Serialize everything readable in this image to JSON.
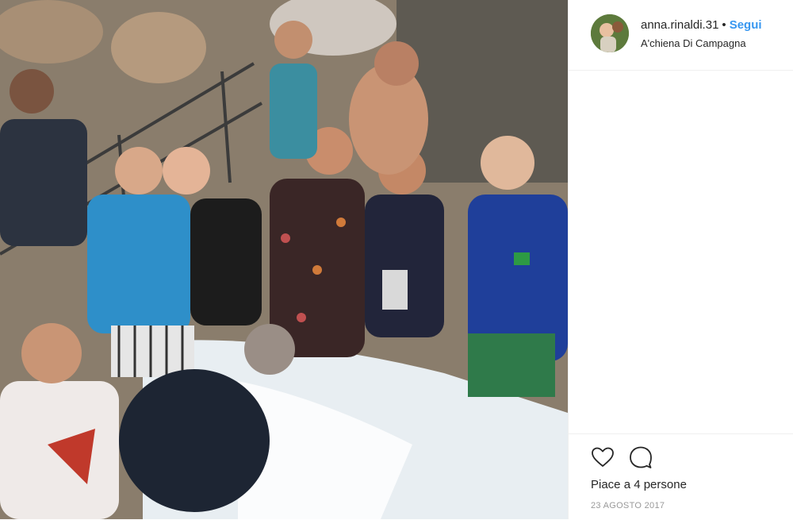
{
  "post": {
    "username": "anna.rinaldi.31",
    "separator": "•",
    "follow_label": "Segui",
    "location": "A'chiena Di Campagna",
    "likes_text": "Piace a 4 persone",
    "date": "23 AGOSTO 2017"
  },
  "icons": {
    "like": "heart-icon",
    "comment": "comment-icon"
  },
  "colors": {
    "follow_blue": "#3897f0",
    "text": "#262626",
    "muted": "#999999",
    "divider": "#efefef"
  }
}
